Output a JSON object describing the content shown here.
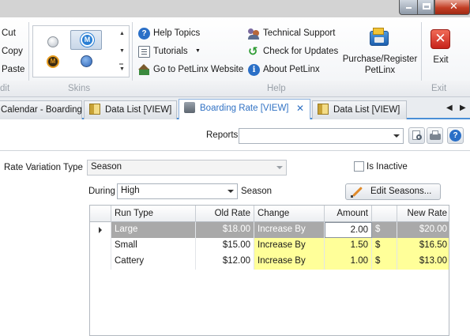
{
  "ribbon": {
    "clipboard": {
      "cut": "Cut",
      "copy": "Copy",
      "paste": "Paste"
    },
    "help": {
      "help_topics": "Help Topics",
      "tutorials": "Tutorials",
      "go_to_website": "Go to PetLinx Website",
      "technical_support": "Technical Support",
      "check_for_updates": "Check for Updates",
      "about": "About PetLinx",
      "purchase": "Purchase/Register PetLinx"
    },
    "exit": "Exit",
    "group_labels": {
      "edit": "dit",
      "skins": "Skins",
      "help": "Help",
      "exit": "Exit"
    }
  },
  "tabs": [
    {
      "label": "Calendar - Boarding"
    },
    {
      "label": "Data List [VIEW]"
    },
    {
      "label": "Boarding Rate [VIEW]"
    },
    {
      "label": "Data List [VIEW]"
    }
  ],
  "reports": {
    "label": "Reports",
    "value": ""
  },
  "form": {
    "rate_variation_label": "Rate Variation Type",
    "rate_variation_value": "Season",
    "is_inactive_label": "Is Inactive",
    "is_inactive_checked": false,
    "during_label": "During",
    "during_value": "High",
    "season_label": "Season",
    "edit_seasons": "Edit Seasons..."
  },
  "grid": {
    "columns": [
      "Run Type",
      "Old Rate",
      "Change",
      "Amount",
      "",
      "New Rate"
    ],
    "rows": [
      {
        "run_type": "Large",
        "old_rate": "$18.00",
        "change": "Increase By",
        "amount": "2.00",
        "unit": "$",
        "new_rate": "$20.00",
        "selected": true
      },
      {
        "run_type": "Small",
        "old_rate": "$15.00",
        "change": "Increase By",
        "amount": "1.50",
        "unit": "$",
        "new_rate": "$16.50",
        "selected": false
      },
      {
        "run_type": "Cattery",
        "old_rate": "$12.00",
        "change": "Increase By",
        "amount": "1.00",
        "unit": "$",
        "new_rate": "$13.00",
        "selected": false
      }
    ]
  },
  "colors": {
    "accent": "#3172c4",
    "selected_row": "#a9a9a9",
    "highlight_cell": "#ffff99"
  }
}
